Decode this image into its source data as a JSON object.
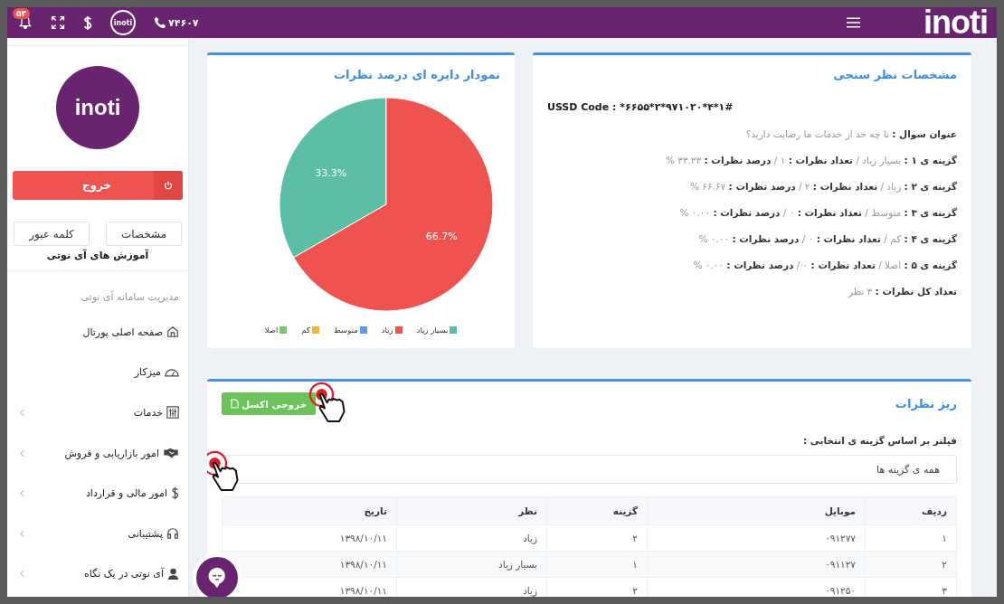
{
  "top_bar": {
    "notification_count": "۵۳",
    "logo_small": "inoti",
    "phone": "۷۴۶۰۷",
    "logo": "inoti"
  },
  "survey_details": {
    "title": "مشخصات نظر سنجی",
    "ussd": "USSD Code : *۶۶۵۵*۲*۹۷۱۰۲۰*۴*۱#",
    "question_label": "عنوان سوال :",
    "question": "تا چه حد از خدمات ما رضایت دارید؟",
    "options": [
      {
        "label": "گزینه ی ۱ :",
        "answer": "بسیار زیاد",
        "separators": [
          "/",
          "/"
        ],
        "count_label": "تعداد نظرات :",
        "count": "۱",
        "percent_label": "درصد نظرات :",
        "percent": "۳۳.۳۳ %"
      },
      {
        "label": "گزینه ی ۲ :",
        "answer": "زیاد",
        "separators": [
          "/",
          "/"
        ],
        "count_label": "تعداد نظرات :",
        "count": "۲",
        "percent_label": "درصد نظرات :",
        "percent": "۶۶.۶۷ %"
      },
      {
        "label": "گزینه ی ۳ :",
        "answer": "متوسط",
        "separators": [
          "/",
          "/"
        ],
        "count_label": "تعداد نظرات :",
        "count": "۰",
        "percent_label": "درصد نظرات :",
        "percent": "۰.۰۰ %"
      },
      {
        "label": "گزینه ی ۴ :",
        "answer": "کم",
        "separators": [
          "/",
          "/"
        ],
        "count_label": "تعداد نظرات :",
        "count": "۰",
        "percent_label": "درصد نظرات :",
        "percent": "۰.۰۰ %"
      },
      {
        "label": "گزینه ی ۵ :",
        "answer": "اصلا",
        "separators": [
          "/",
          "/"
        ],
        "count_label": "تعداد نظرات :",
        "count": "۰",
        "percent_label": "درصد نظرات :",
        "percent": "۰.۰۰ %"
      }
    ],
    "total_label": "تعداد کل نظرات :",
    "total": "۳ نظر"
  },
  "pie_card": {
    "title": "نمودار دایره ای درصد نظرات",
    "slice_colors": [
      {
        "color": "#5cbfa5"
      },
      {
        "color": "#ef5350"
      },
      {
        "color": "#5a9bef"
      },
      {
        "color": "#fbb13c"
      },
      {
        "color": "#7ac76a"
      }
    ],
    "chart_data": {
      "type": "pie",
      "categories": [
        "بسیار زیاد",
        "زیاد",
        "متوسط",
        "کم",
        "اصلا"
      ],
      "values": [
        33.3,
        66.7,
        0,
        0,
        0
      ],
      "value_labels": [
        "33.3%",
        "66.7%",
        null,
        null,
        null
      ]
    }
  },
  "details": {
    "title": "ریز نظرات",
    "export_button": "خروجی اکسل",
    "filter_label": "فیلتر بر اساس گزینه ی انتخابی :",
    "filter_value": "همه ی گزینه ها",
    "columns": [
      "ردیف",
      "موبایل",
      "گزینه",
      "نظر",
      "تاریخ"
    ],
    "rows": [
      [
        "۱",
        "۰۹۱۲۷۷",
        "۲",
        "زیاد",
        "۱۳۹۸/۱۰/۱۱"
      ],
      [
        "۲",
        "۰۹۱۱۲۷",
        "۱",
        "بسیار زیاد",
        "۱۳۹۸/۱۰/۱۱"
      ],
      [
        "۳",
        "۰۹۱۲۵۰",
        "۲",
        "زیاد",
        "۱۳۹۸/۱۰/۱۱"
      ]
    ]
  },
  "sidebar": {
    "logo": "inoti",
    "logout_button": "خروج",
    "profile_button": "مشخصات",
    "password_button": "کلمه عبور",
    "tutorials_link": "آموزش های آی نوتی",
    "section_title": "مدیریت سامانه آی نوتی",
    "items": [
      {
        "label": "صفحه اصلی پورتال",
        "expandable": false
      },
      {
        "label": "میزکار",
        "expandable": false
      },
      {
        "label": "خدمات",
        "expandable": true
      },
      {
        "label": "امور بازاریابی و فروش",
        "expandable": true
      },
      {
        "label": "امور مالی و قرارداد",
        "expandable": true
      },
      {
        "label": "پشتیبانی",
        "expandable": true
      },
      {
        "label": "آی نوتی در یک نگاه",
        "expandable": true
      }
    ]
  }
}
